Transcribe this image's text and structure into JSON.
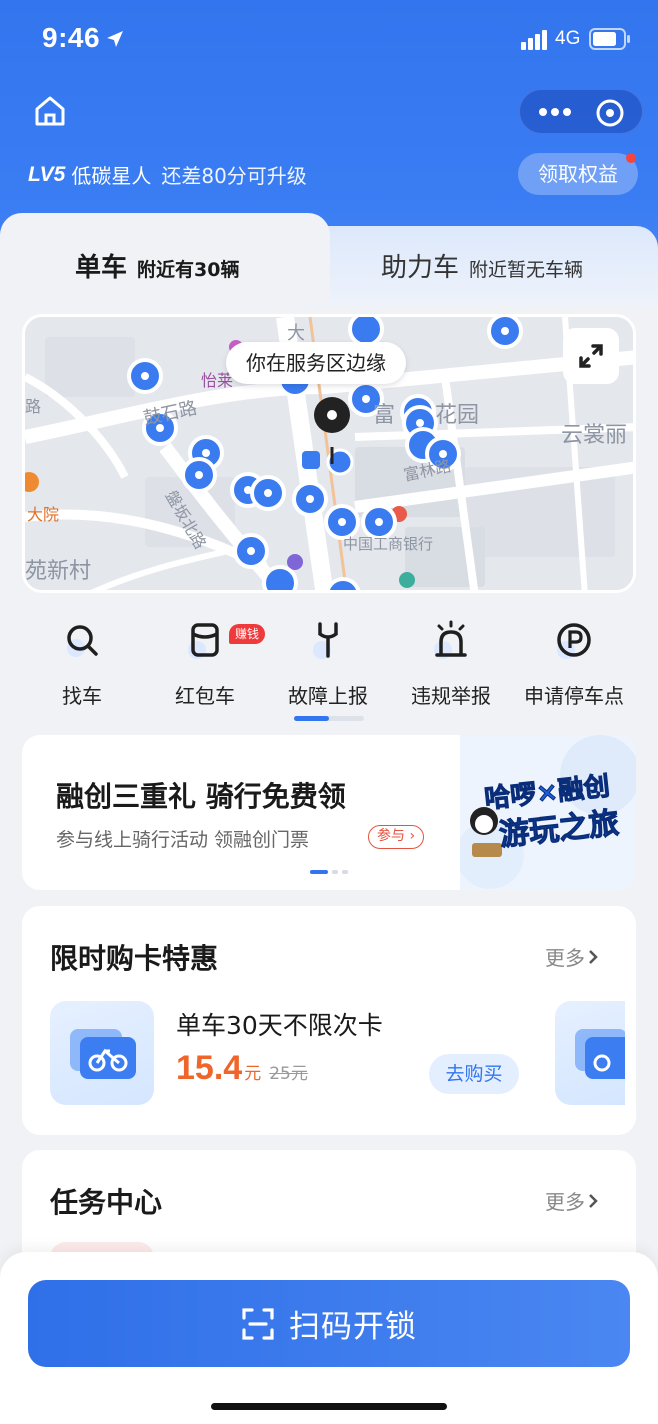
{
  "status_bar": {
    "time": "9:46",
    "network": "4G"
  },
  "header": {
    "level_badge": "LV5",
    "level_title": "低碳星人",
    "level_tip": "还差80分可升级",
    "rights_button": "领取权益"
  },
  "tabs": [
    {
      "label": "单车",
      "sub": "附近有30辆",
      "active": true
    },
    {
      "label": "助力车",
      "sub": "附近暂无车辆",
      "active": false
    }
  ],
  "map": {
    "bubble": "你在服务区边缘",
    "labels": [
      "怡莱",
      "富",
      "花园",
      "云裳丽",
      "鼓石路",
      "富林路",
      "盤坂北路",
      "大院",
      "苑新村",
      "中国工商银行",
      "大",
      "路"
    ]
  },
  "actions": [
    {
      "label": "找车",
      "icon": "search-icon"
    },
    {
      "label": "红包车",
      "icon": "red-packet-icon",
      "badge": "赚钱"
    },
    {
      "label": "故障上报",
      "icon": "wrench-icon"
    },
    {
      "label": "违规举报",
      "icon": "alarm-icon"
    },
    {
      "label": "申请停车点",
      "icon": "parking-icon"
    }
  ],
  "banner": {
    "title": "融创三重礼  骑行免费领",
    "subtitle": "参与线上骑行活动 领融创门票",
    "join": "参与",
    "art_line1": "哈啰×融创",
    "art_line2": "游玩之旅"
  },
  "promo": {
    "title": "限时购卡特惠",
    "more": "更多",
    "product_name": "单车30天不限次卡",
    "price": "15.4",
    "price_unit": "元",
    "old_price": "25元",
    "buy": "去购买"
  },
  "tasks": {
    "title": "任务中心",
    "more": "更多"
  },
  "scan_button": "扫码开锁",
  "colors": {
    "accent": "#3275ee",
    "price": "#f0652a",
    "badge_red": "#f0393a"
  }
}
